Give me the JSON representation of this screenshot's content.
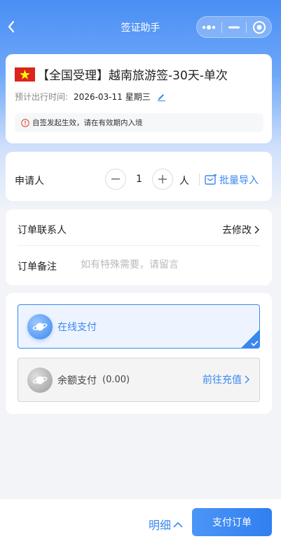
{
  "nav": {
    "title": "签证助手"
  },
  "product": {
    "name": "【全国受理】越南旅游签-30天-单次",
    "date_label": "预计出行时间:",
    "date_value": "2026-03-11",
    "weekday": "星期三",
    "notice": "自签发起生效，请在有效期内入境"
  },
  "applicants": {
    "label": "申请人",
    "count": "1",
    "unit": "人",
    "batch_label": "批量导入"
  },
  "order": {
    "contact_label": "订单联系人",
    "contact_action": "去修改",
    "remark_label": "订单备注",
    "remark_placeholder": "如有特殊需要，请留言"
  },
  "payment": {
    "online_label": "在线支付",
    "balance_label": "余额支付",
    "balance_amount": "(0.00)",
    "recharge_label": "前往充值",
    "selected": "online"
  },
  "bottom": {
    "detail_label": "明细",
    "pay_label": "支付订单"
  },
  "colors": {
    "accent": "#3a87f0",
    "flag_red": "#da251d",
    "flag_star": "#ffff00",
    "notice_icon": "#e54d42"
  },
  "icons": {
    "back": "chevron-left-icon",
    "more": "more-dots-icon",
    "minimize": "minimize-icon",
    "target": "target-icon",
    "edit": "edit-icon",
    "info": "info-icon",
    "minus": "minus-icon",
    "plus": "plus-icon",
    "import": "import-icon",
    "online_pay": "planet-icon",
    "balance_pay": "planet-icon",
    "check": "check-icon"
  }
}
